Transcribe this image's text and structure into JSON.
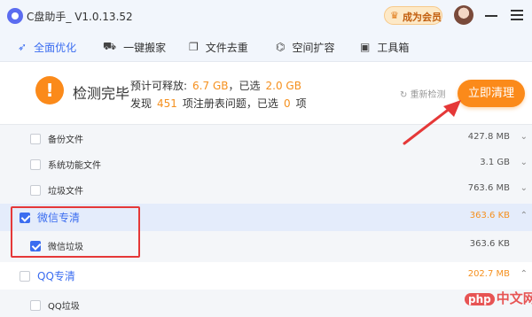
{
  "app": {
    "title": "C盘助手_ V1.0.13.52",
    "vip_label": "成为会员"
  },
  "tabs": [
    {
      "label": "全面优化",
      "icon": "rocket-icon",
      "active": true
    },
    {
      "label": "一键搬家",
      "icon": "truck-icon",
      "active": false
    },
    {
      "label": "文件去重",
      "icon": "copy-icon",
      "active": false
    },
    {
      "label": "空间扩容",
      "icon": "expand-icon",
      "active": false
    },
    {
      "label": "工具箱",
      "icon": "toolbox-icon",
      "active": false
    }
  ],
  "summary": {
    "status_title": "检测完毕",
    "line1": {
      "prefix": "预计可释放:",
      "size": "6.7 GB",
      "mid": "已选",
      "selected": "2.0 GB"
    },
    "line2": {
      "prefix": "发现",
      "count": "451",
      "mid": "项注册表问题，已选",
      "selected": "0",
      "suffix": "项"
    },
    "recheck_label": "重新检测",
    "clean_label": "立即清理"
  },
  "rows": [
    {
      "label": "备份文件",
      "size": "427.8 MB",
      "checked": false,
      "group": false
    },
    {
      "label": "系统功能文件",
      "size": "3.1 GB",
      "checked": false,
      "group": false
    },
    {
      "label": "垃圾文件",
      "size": "763.6 MB",
      "checked": false,
      "group": false
    },
    {
      "label": "微信专清",
      "size": "363.6 KB",
      "checked": true,
      "group": true
    },
    {
      "label": "微信垃圾",
      "size": "363.6 KB",
      "checked": true,
      "group": false
    },
    {
      "label": "QQ专清",
      "size": "202.7 MB",
      "checked": false,
      "group": true
    },
    {
      "label": "QQ垃圾",
      "size": "",
      "checked": false,
      "group": false
    }
  ],
  "watermark": {
    "badge": "php",
    "text": "中文网"
  },
  "colors": {
    "accent": "#3b6df0",
    "orange": "#fb8a1a",
    "annotation_red": "#e53838"
  }
}
